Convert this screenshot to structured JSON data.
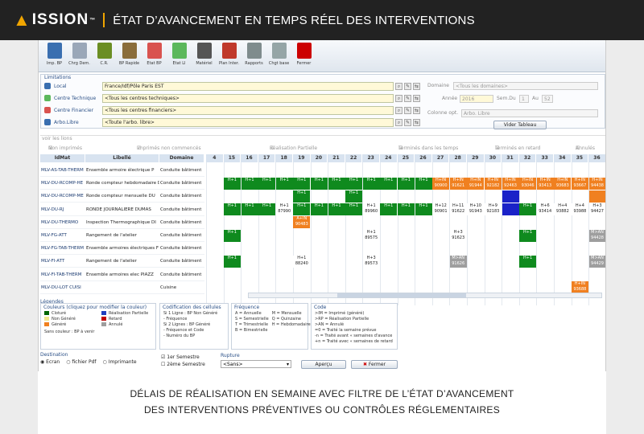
{
  "brand": {
    "name": "ISSION",
    "tm": "™",
    "title": "ÉTAT D’AVANCEMENT EN TEMPS RÉEL DES INTERVENTIONS"
  },
  "toolbar": [
    {
      "label": "Imp. BP",
      "color": "#3a6fb0",
      "icon": "printer-icon"
    },
    {
      "label": "Chrg Dem.",
      "color": "#9aa7b8",
      "icon": "load-icon"
    },
    {
      "label": "C.R.",
      "color": "#6b8e23",
      "icon": "report-icon"
    },
    {
      "label": "BP Rapide",
      "color": "#8a6d3b",
      "icon": "quick-icon"
    },
    {
      "label": "Etat BP",
      "color": "#d9534f",
      "icon": "state-icon"
    },
    {
      "label": "Etat LI",
      "color": "#5cb85c",
      "icon": "traffic-light-icon"
    },
    {
      "label": "Matériel",
      "color": "#555555",
      "icon": "gear-icon"
    },
    {
      "label": "Plan Inter.",
      "color": "#c0392b",
      "icon": "calendar-icon"
    },
    {
      "label": "Rapports",
      "color": "#7f8c8d",
      "icon": "reports-icon"
    },
    {
      "label": "Chgt base",
      "color": "#95a5a6",
      "icon": "database-icon"
    },
    {
      "label": "Fermer",
      "color": "#cc0000",
      "icon": "close-icon"
    }
  ],
  "limitations": {
    "title": "Limitations",
    "local": {
      "label": "Local",
      "value": "France/Idf/Pôle Paris EST"
    },
    "centre_technique": {
      "label": "Centre Technique",
      "value": "<Tous les centres techniques>"
    },
    "centre_financier": {
      "label": "Centre Financier",
      "value": "<Tous les centres financiers>"
    },
    "arbo": {
      "label": "Arbo.Libre",
      "value": "<Toute l'arbo. libre>"
    },
    "domaine_label": "Domaine",
    "domaine_value": "<Tous les domaines>",
    "annee_label": "Année",
    "annee_value": "2016",
    "semdu_label": "Sem.Du",
    "semdu_value": "1",
    "au_label": "Au",
    "au_value": "52",
    "colonne_label": "Colonne opt.",
    "colonne_value": "Arbo. Libre",
    "vider_label": "Vider Tableau"
  },
  "voir": {
    "title": "voir les lions",
    "options": [
      "Non imprimés",
      "Imprimés non commencés",
      "Réalisation Partielle",
      "Terminés dans les temps",
      "Terminés en retard",
      "Annulés"
    ]
  },
  "grid": {
    "headers": {
      "idmat": "IdMat",
      "libelle": "Libellé",
      "domaine": "Domaine"
    },
    "weeks": [
      "4",
      "15",
      "16",
      "17",
      "18",
      "19",
      "20",
      "21",
      "22",
      "23",
      "24",
      "25",
      "26",
      "27",
      "28",
      "29",
      "30",
      "31",
      "32",
      "33",
      "34",
      "35",
      "36"
    ],
    "rows": [
      {
        "id": "MLV-AS-TAB-THERM",
        "lib": "Ensemble armoire électrique P",
        "dom": "Conduite bâtiment",
        "cells": {}
      },
      {
        "id": "MLV-DU-RCOMP-HE",
        "lib": "Ronde compteur hebdomadaire D",
        "dom": "Conduite bâtiment",
        "cells": {
          "15": [
            "g",
            "H+1"
          ],
          "16": [
            "g",
            "H+1"
          ],
          "17": [
            "g",
            "H+1"
          ],
          "18": [
            "g",
            "H+1"
          ],
          "19": [
            "g",
            "H+1"
          ],
          "20": [
            "g",
            "H+1"
          ],
          "21": [
            "g",
            "H+1"
          ],
          "22": [
            "g",
            "H+1"
          ],
          "23": [
            "g",
            "H+1"
          ],
          "24": [
            "g",
            "H+1"
          ],
          "25": [
            "g",
            "H+1"
          ],
          "26": [
            "g",
            "H+1"
          ],
          "27": [
            "o",
            "H+IN 90900"
          ],
          "28": [
            "o",
            "H+IN 91621"
          ],
          "29": [
            "o",
            "H+IN 91944"
          ],
          "30": [
            "o",
            "H+IN 92182"
          ],
          "31": [
            "o",
            "H+IN 92463"
          ],
          "32": [
            "o",
            "H+IN 93046"
          ],
          "33": [
            "o",
            "H+IN 93413"
          ],
          "34": [
            "o",
            "H+IN 93683"
          ],
          "35": [
            "o",
            "H+IN 93667"
          ],
          "36": [
            "o",
            "H+IN 94438"
          ]
        }
      },
      {
        "id": "MLV-DU-RCOMP-ME",
        "lib": "Ronde compteur mensuelle DU",
        "dom": "Conduite bâtiment",
        "cells": {
          "19": [
            "g",
            "H+1"
          ],
          "22": [
            "g",
            "H+1"
          ],
          "31": [
            "b",
            ""
          ],
          "36": [
            "o",
            ""
          ]
        }
      },
      {
        "id": "MLV-DU-RJ",
        "lib": "RONDE JOURNALIERE DUMAS",
        "dom": "Conduite bâtiment",
        "cells": {
          "15": [
            "g",
            "H+1"
          ],
          "16": [
            "g",
            "H+1"
          ],
          "17": [
            "g",
            "H+1"
          ],
          "18": [
            "w",
            "H+1 87990"
          ],
          "19": [
            "g",
            "H+1"
          ],
          "20": [
            "g",
            "H+1"
          ],
          "21": [
            "g",
            "H+1"
          ],
          "22": [
            "g",
            "H+1"
          ],
          "23": [
            "w",
            "H+1 89960"
          ],
          "24": [
            "g",
            "H+1"
          ],
          "25": [
            "g",
            "H+1"
          ],
          "26": [
            "g",
            "H+1"
          ],
          "27": [
            "w",
            "H+12 90901"
          ],
          "28": [
            "w",
            "H+11 91622"
          ],
          "29": [
            "w",
            "H+10 91943"
          ],
          "30": [
            "w",
            "H+9 92183"
          ],
          "31": [
            "b",
            ""
          ],
          "32": [
            "g",
            "H+1"
          ],
          "33": [
            "w",
            "H+6 93414"
          ],
          "34": [
            "w",
            "H+4 93882"
          ],
          "35": [
            "w",
            "H+4 93988"
          ],
          "36": [
            "w",
            "H+3 94427"
          ]
        }
      },
      {
        "id": "MLV-DU-THERMO",
        "lib": "Inspection Thermographique DI",
        "dom": "Conduite bâtiment",
        "cells": {
          "19": [
            "o",
            "A+IN 90483"
          ]
        }
      },
      {
        "id": "MLV-FG-ATT",
        "lib": "Rangement de l'atelier",
        "dom": "Conduite bâtiment",
        "cells": {
          "15": [
            "g",
            "H+1"
          ],
          "23": [
            "w",
            "H+1 89575"
          ],
          "28": [
            "w",
            "H+3 91623"
          ],
          "32": [
            "g",
            "H+1"
          ],
          "36": [
            "s",
            "M>AN 94428"
          ]
        }
      },
      {
        "id": "MLV-FG-TAB-THERM",
        "lib": "Ensemble armoires électriques F",
        "dom": "Conduite bâtiment",
        "cells": {}
      },
      {
        "id": "MLV-FI-ATT",
        "lib": "Rangement de l'atelier",
        "dom": "Conduite bâtiment",
        "cells": {
          "15": [
            "g",
            "H+1"
          ],
          "19": [
            "w",
            "H+1 88240"
          ],
          "23": [
            "w",
            "H+3 89573"
          ],
          "28": [
            "s",
            "M>AN 91626"
          ],
          "32": [
            "g",
            "H+1"
          ],
          "36": [
            "s",
            "M>AN 94429"
          ]
        }
      },
      {
        "id": "MLV-FI-TAB-THERM",
        "lib": "Ensemble armoires elec PIAZZ",
        "dom": "Conduite bâtiment",
        "cells": {}
      },
      {
        "id": "MLV-DU-LOT CUISI",
        "lib": "",
        "dom": "Cuisine",
        "cells": {
          "35": [
            "o",
            "H+IN 93688"
          ]
        }
      }
    ]
  },
  "legend": {
    "couleurs": {
      "title": "Couleurs (cliquez pour modifier la couleur)",
      "items": [
        [
          "Cloturé",
          "#006400"
        ],
        [
          "Réalisation Partielle",
          "#1f3fbf"
        ],
        [
          "Non Généré",
          "#f0e68c"
        ],
        [
          "Retard",
          "#c00000"
        ],
        [
          "Généré",
          "#f08020"
        ],
        [
          "Annulé",
          "#9e9e9e"
        ]
      ],
      "note": "Sans couleur : BP à venir"
    },
    "codif": {
      "title": "Codification des cellules",
      "lines": [
        "Si 1 Ligne : BP Non Généré",
        "- Fréquence",
        "Si 2 Lignes : BP Généré",
        "- Fréquence et Code",
        "- Numéro du BP"
      ]
    },
    "frequence": {
      "title": "Fréquence",
      "lines": [
        "A = Annuelle",
        "M = Mensuelle",
        "S = Semestrielle",
        "Q = Quinzaine",
        "T = Trimestrielle",
        "H = Hebdomadaire",
        "B = Bimestrielle"
      ]
    },
    "code": {
      "title": "Code",
      "lines": [
        ">IM = Imprimé (généré)",
        ">RP = Réalisation Partielle",
        ">AN = Annulé",
        "=0 = Traité la semaine prévue",
        "-n = Traité avant « semaines d'avance",
        "+n = Traité avec « semaines de retard"
      ]
    }
  },
  "footer": {
    "destination": "Destination",
    "ecran": "Ecran",
    "fichier": "fichier Pdf",
    "imprimante": "Imprimante",
    "sem1": "1er Semestre",
    "sem2": "2ème Semestre",
    "rupture": "Rupture",
    "rupture_value": "<Sans>",
    "apercu": "Aperçu",
    "fermer": "Fermer"
  },
  "caption": {
    "line1": "DÉLAIS DE RÉALISATION EN SEMAINE AVEC FILTRE DE L’ÉTAT D’AVANCEMENT",
    "line2": "DES INTERVENTIONS PRÉVENTIVES OU CONTRÔLES RÉGLEMENTAIRES"
  },
  "colors": {
    "green": "#0f8a1e",
    "orange": "#f08020",
    "blue": "#1a22c8",
    "grey": "#9e9e9e"
  }
}
